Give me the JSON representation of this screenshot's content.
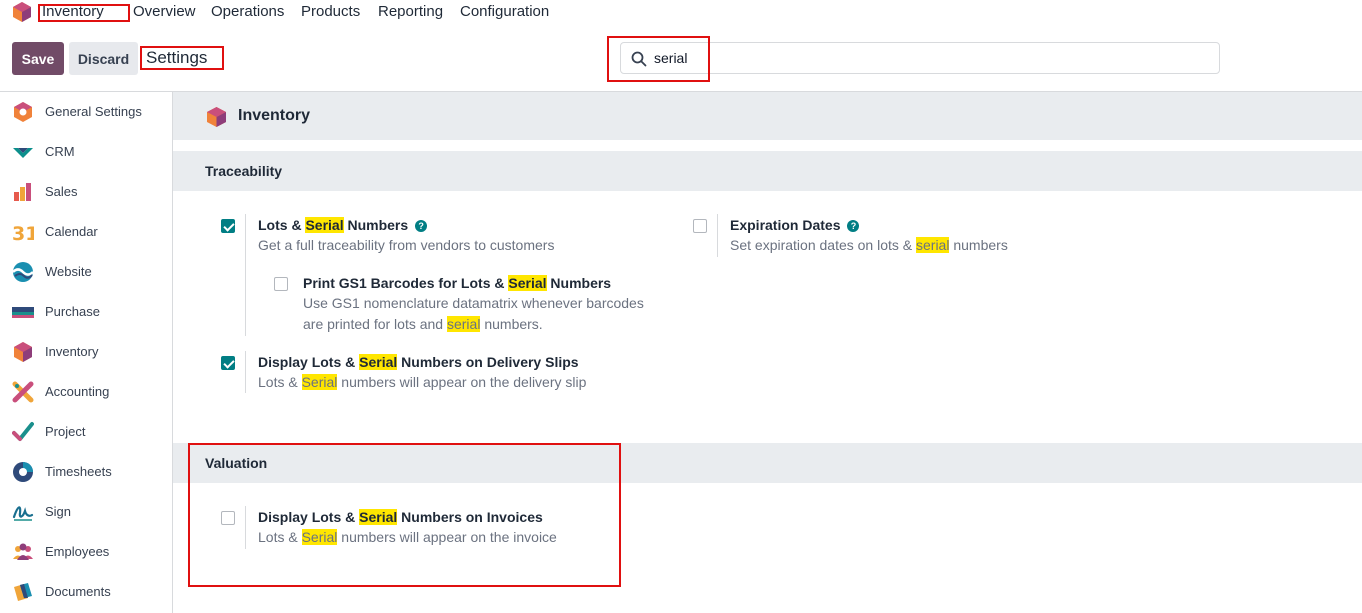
{
  "topnav": {
    "app_name": "Inventory",
    "menu": [
      "Overview",
      "Operations",
      "Products",
      "Reporting",
      "Configuration"
    ]
  },
  "control": {
    "save_label": "Save",
    "discard_label": "Discard",
    "breadcrumb": "Settings"
  },
  "search": {
    "value": "serial"
  },
  "sidebar": {
    "items": [
      {
        "label": "General Settings",
        "icon": "general-settings-icon"
      },
      {
        "label": "CRM",
        "icon": "crm-icon"
      },
      {
        "label": "Sales",
        "icon": "sales-icon"
      },
      {
        "label": "Calendar",
        "icon": "calendar-icon",
        "glyph": "31"
      },
      {
        "label": "Website",
        "icon": "website-icon"
      },
      {
        "label": "Purchase",
        "icon": "purchase-icon"
      },
      {
        "label": "Inventory",
        "icon": "inventory-icon"
      },
      {
        "label": "Accounting",
        "icon": "accounting-icon"
      },
      {
        "label": "Project",
        "icon": "project-icon"
      },
      {
        "label": "Timesheets",
        "icon": "timesheets-icon"
      },
      {
        "label": "Sign",
        "icon": "sign-icon"
      },
      {
        "label": "Employees",
        "icon": "employees-icon"
      },
      {
        "label": "Documents",
        "icon": "documents-icon"
      }
    ]
  },
  "main": {
    "app_title": "Inventory",
    "traceability": {
      "title": "Traceability",
      "lots_serial": {
        "checked": true,
        "title_a": "Lots & ",
        "title_hl": "Serial",
        "title_b": " Numbers",
        "desc": "Get a full traceability from vendors to customers"
      },
      "gs1": {
        "checked": false,
        "title_a": "Print GS1 Barcodes for Lots & ",
        "title_hl": "Serial",
        "title_b": " Numbers",
        "desc_line1": "Use GS1 nomenclature datamatrix whenever barcodes",
        "desc_line2_a": "are printed for lots and ",
        "desc_line2_hl": "serial",
        "desc_line2_b": " numbers."
      },
      "delivery": {
        "checked": true,
        "title_a": "Display Lots & ",
        "title_hl": "Serial",
        "title_b": " Numbers on Delivery Slips",
        "desc_a": "Lots & ",
        "desc_hl": "Serial",
        "desc_b": " numbers will appear on the delivery slip"
      },
      "expiration": {
        "checked": false,
        "title": "Expiration Dates",
        "desc_a": "Set expiration dates on lots & ",
        "desc_hl": "serial",
        "desc_b": " numbers"
      }
    },
    "valuation": {
      "title": "Valuation",
      "invoices": {
        "checked": false,
        "title_a": "Display Lots & ",
        "title_hl": "Serial",
        "title_b": " Numbers on Invoices",
        "desc_a": "Lots & ",
        "desc_hl": "Serial",
        "desc_b": " numbers will appear on the invoice"
      }
    }
  },
  "colors": {
    "primary": "#714b67",
    "accent": "#017e84",
    "highlight": "#ffe600",
    "annotation": "#e01010"
  }
}
